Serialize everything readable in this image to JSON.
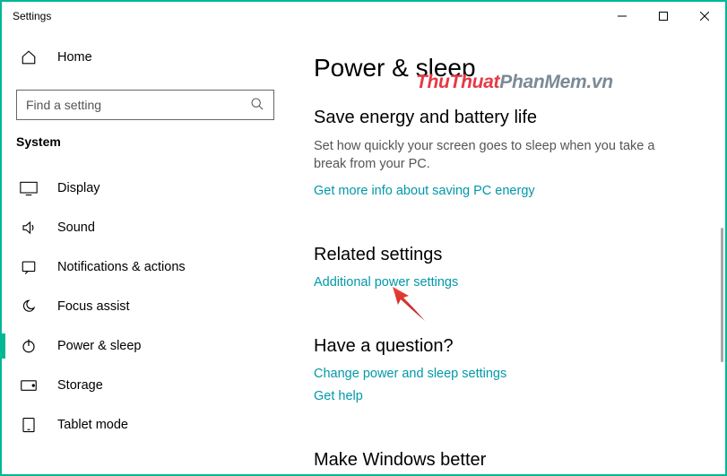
{
  "window": {
    "title": "Settings"
  },
  "sidebar": {
    "home_label": "Home",
    "search_placeholder": "Find a setting",
    "category_label": "System",
    "items": [
      {
        "label": "Display",
        "icon": "display-icon"
      },
      {
        "label": "Sound",
        "icon": "sound-icon"
      },
      {
        "label": "Notifications & actions",
        "icon": "notifications-icon"
      },
      {
        "label": "Focus assist",
        "icon": "focus-assist-icon"
      },
      {
        "label": "Power & sleep",
        "icon": "power-icon"
      },
      {
        "label": "Storage",
        "icon": "storage-icon"
      },
      {
        "label": "Tablet mode",
        "icon": "tablet-icon"
      }
    ]
  },
  "main": {
    "title": "Power & sleep",
    "energy_section": {
      "title": "Save energy and battery life",
      "desc": "Set how quickly your screen goes to sleep when you take a break from your PC.",
      "link": "Get more info about saving PC energy"
    },
    "related_section": {
      "title": "Related settings",
      "link": "Additional power settings"
    },
    "question_section": {
      "title": "Have a question?",
      "link1": "Change power and sleep settings",
      "link2": "Get help"
    },
    "better_section": {
      "title": "Make Windows better"
    }
  },
  "watermark": {
    "p1": "ThuThuat",
    "p2": "PhanMem",
    "p3": ".vn"
  }
}
